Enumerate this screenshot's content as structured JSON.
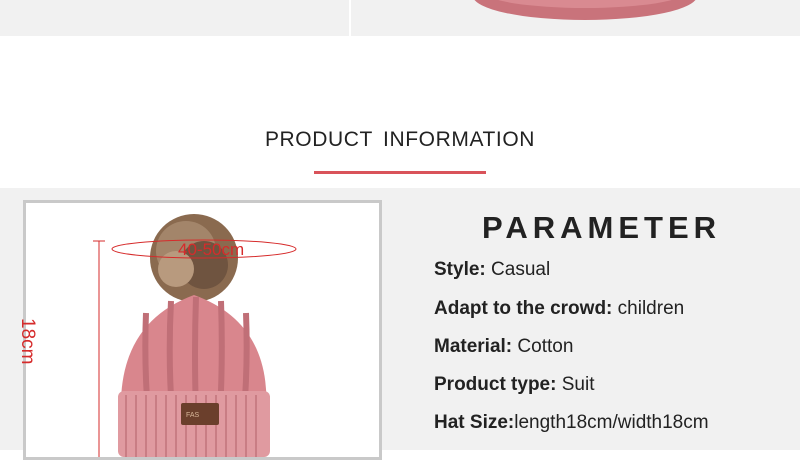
{
  "section": {
    "title": "PRODUCT  INFORMATION"
  },
  "photo": {
    "height_label": "18cm",
    "circumference_label": "40-50cm",
    "patch_text": "FAS"
  },
  "parameters": {
    "title": "PARAMETER",
    "rows": [
      {
        "label": "Style:",
        "value": " Casual"
      },
      {
        "label": "Adapt to the crowd:",
        "value": " children"
      },
      {
        "label": "Material:",
        "value": " Cotton"
      },
      {
        "label": "Product type:",
        "value": " Suit"
      },
      {
        "label": "Hat Size:",
        "value": "length18cm/width18cm"
      }
    ]
  },
  "colors": {
    "accent": "#d9535a",
    "dimension": "#d62b2b",
    "hat_pink": "#d9868d",
    "panel_bg": "#f1f1f1"
  }
}
